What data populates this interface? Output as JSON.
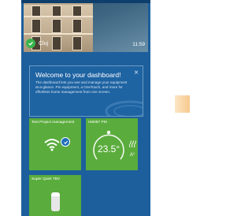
{
  "hero": {
    "location": "Cluj",
    "time": "11:59"
  },
  "welcome": {
    "title": "Welcome to your dashboard!",
    "body": "The dashboard lets you see and manage your equipment at-a-glance. Pin equipment, a OneTouch, and more for effortless home management from one screen.",
    "close_label": "×"
  },
  "tiles": [
    {
      "label": "Test Project management",
      "icon": "wifi-icon"
    },
    {
      "label": "IS6087 PM",
      "temperature": "23.5°",
      "mode": "A°",
      "icon": "heat-icon"
    },
    {
      "label": "Super Quiet TBV",
      "icon": "purifier-icon"
    }
  ],
  "colors": {
    "phone_bg": "#1c5f9c",
    "tile_green": "#5aac3c",
    "check_green": "#38b54a"
  }
}
